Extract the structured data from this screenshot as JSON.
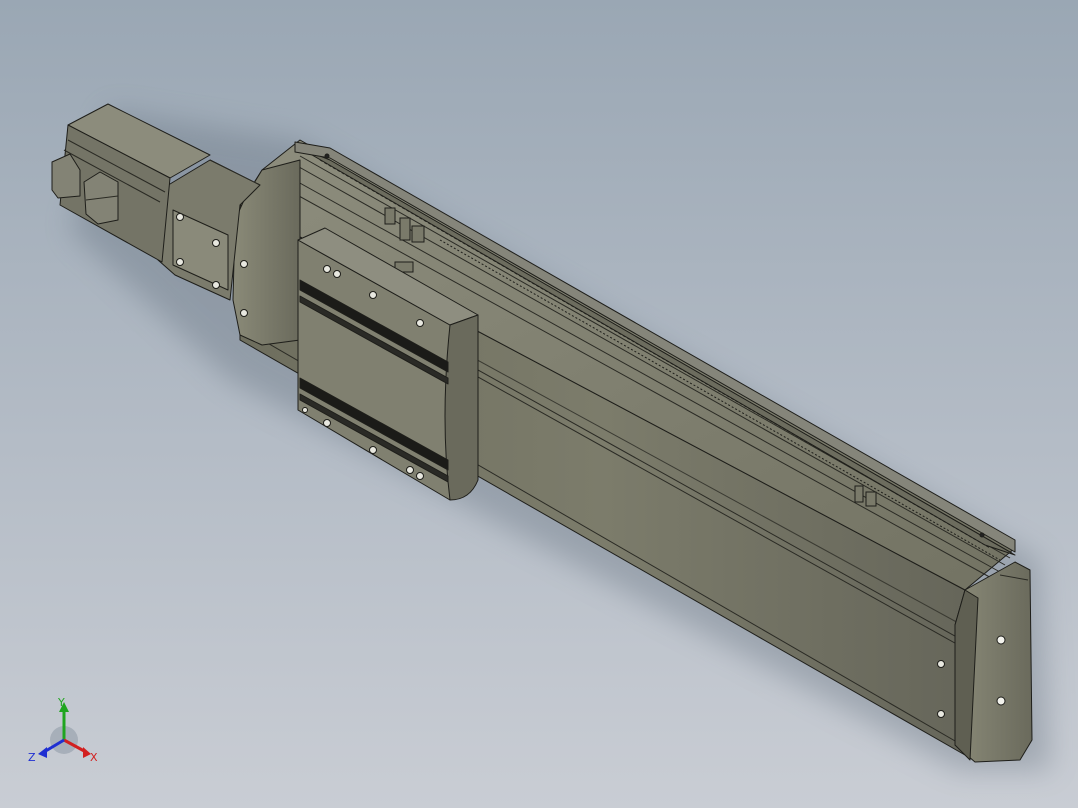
{
  "viewport": {
    "background_top": "#9aa7b4",
    "background_bottom": "#c9cdd4",
    "model_body_color": "#7a7a68",
    "model_edge_color": "#1e1e1a"
  },
  "triad": {
    "x_label": "X",
    "y_label": "Y",
    "z_label": "Z",
    "x_color": "#d22020",
    "y_color": "#1fa51f",
    "z_color": "#1f2fd2"
  }
}
